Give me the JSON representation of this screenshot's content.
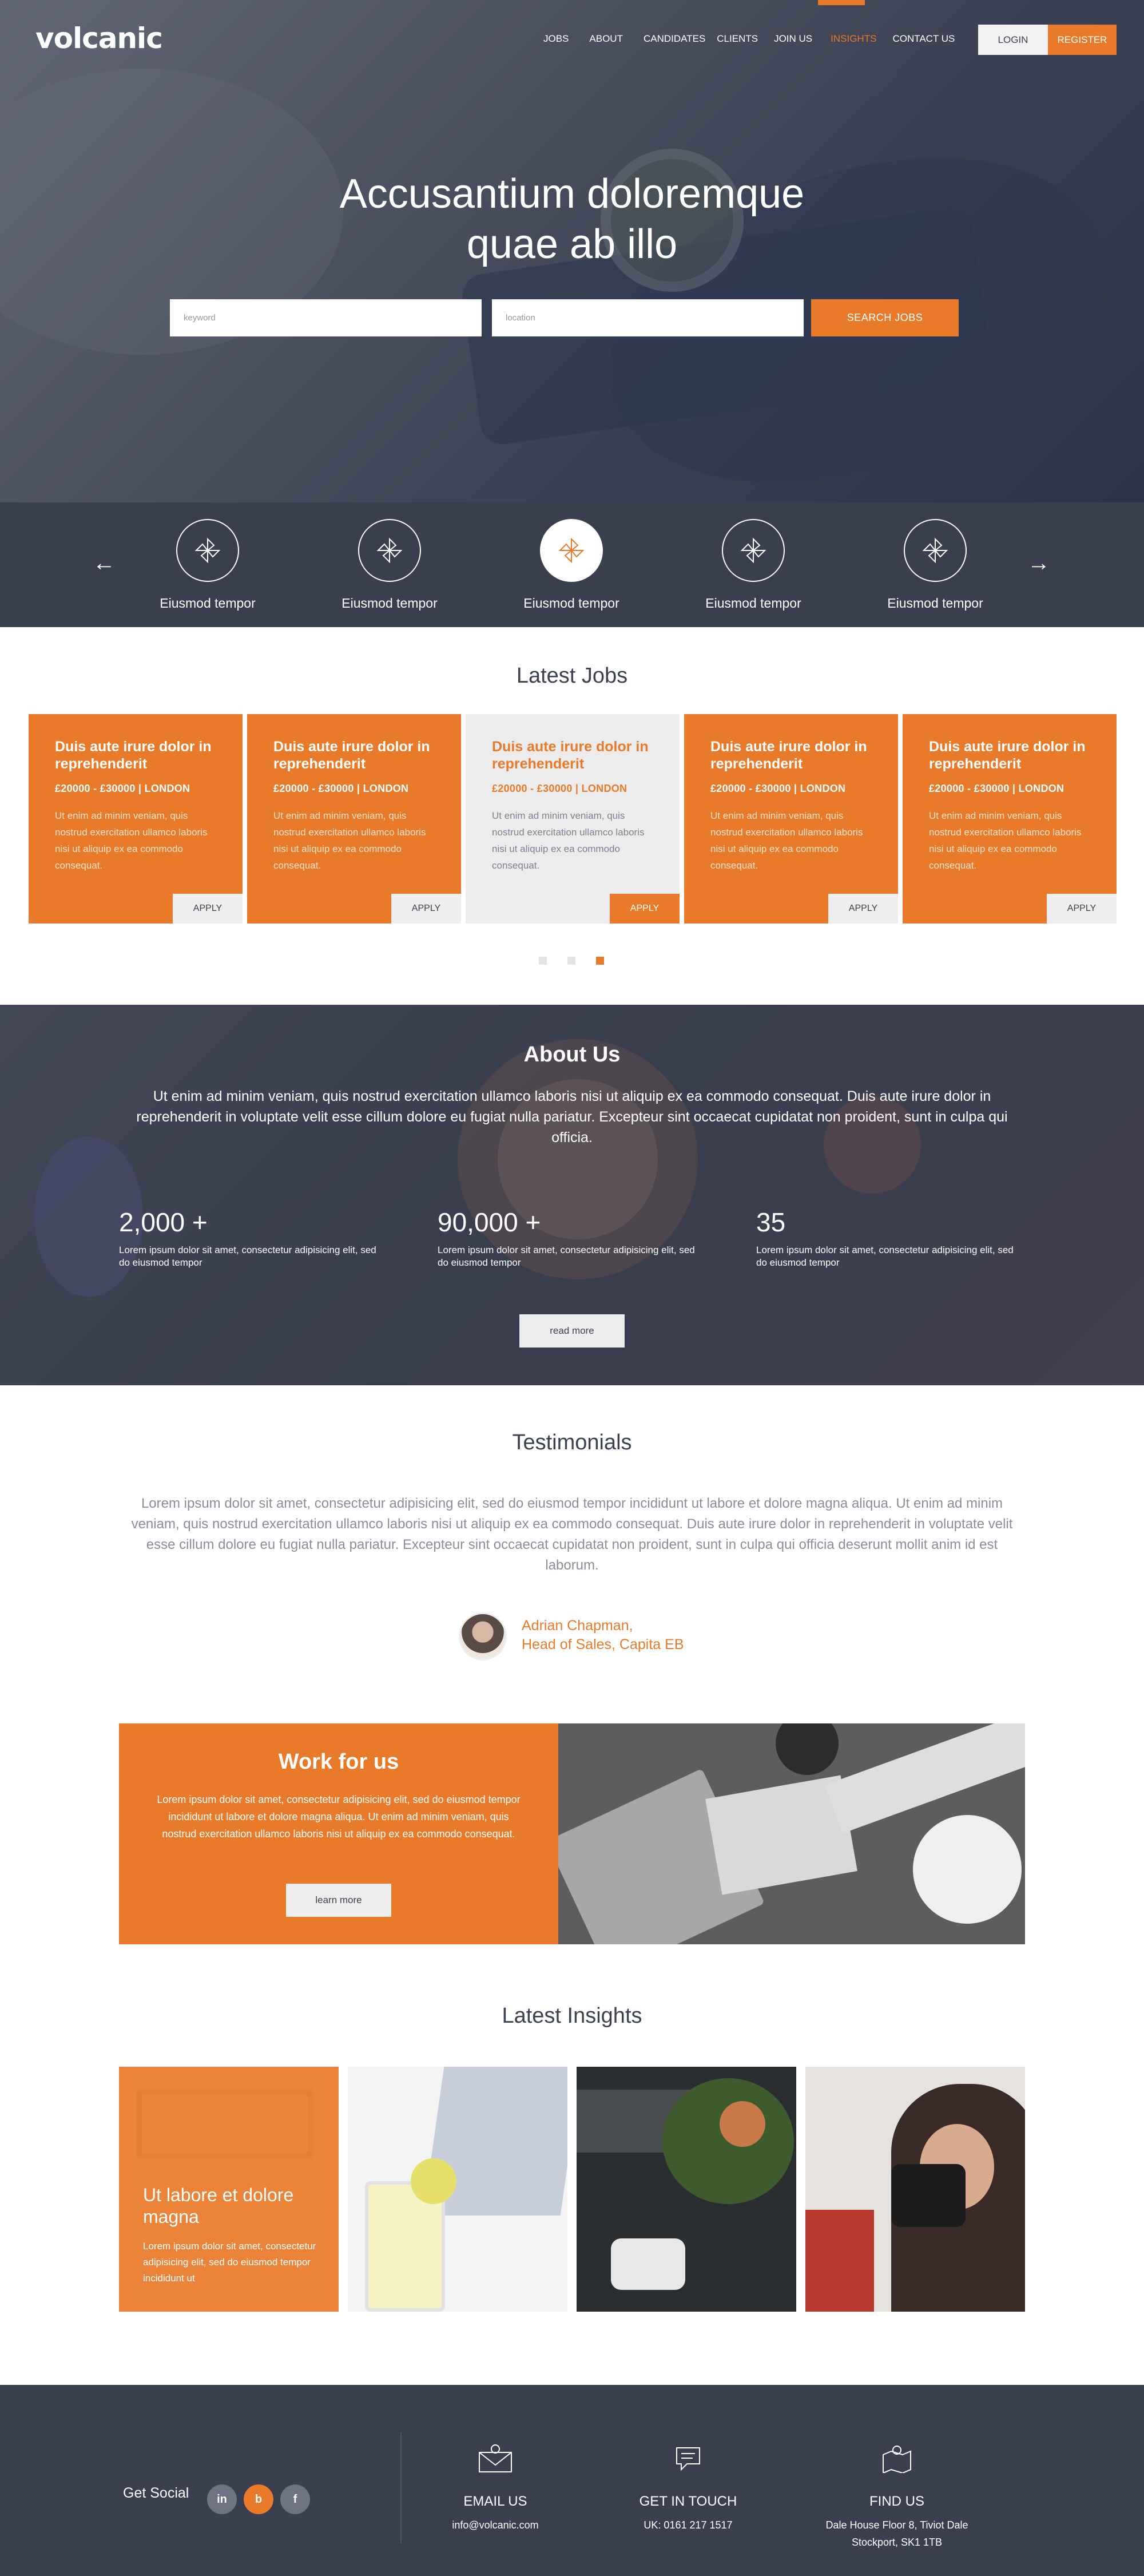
{
  "brand": {
    "logo": "volcanic",
    "accent_color": "#e87a2a",
    "dark_color": "#3a3f50"
  },
  "nav": {
    "items": [
      "JOBS",
      "ABOUT",
      "CANDIDATES",
      "CLIENTS",
      "JOIN US",
      "INSIGHTS",
      "CONTACT US"
    ],
    "active": "INSIGHTS",
    "login": "LOGIN",
    "register": "REGISTER"
  },
  "hero": {
    "title_line1": "Accusantium doloremque",
    "title_line2": "quae ab illo",
    "keyword_placeholder": "keyword",
    "location_placeholder": "location",
    "search_button": "SEARCH JOBS"
  },
  "categories": {
    "items": [
      "Eiusmod tempor",
      "Eiusmod tempor",
      "Eiusmod tempor",
      "Eiusmod tempor",
      "Eiusmod tempor"
    ],
    "icon": "pinwheel-icon",
    "active_index": 2
  },
  "latest_jobs": {
    "title": "Latest Jobs",
    "cards": [
      {
        "title": "Duis aute irure dolor in reprehenderit",
        "salary": "£20000 - £30000 | LONDON",
        "desc": "Ut enim ad minim veniam, quis nostrud exercitation ullamco laboris nisi ut aliquip ex ea commodo consequat.",
        "apply": "APPLY"
      },
      {
        "title": "Duis aute irure dolor in reprehenderit",
        "salary": "£20000 - £30000 | LONDON",
        "desc": "Ut enim ad minim veniam, quis nostrud exercitation ullamco laboris nisi ut aliquip ex ea commodo consequat.",
        "apply": "APPLY"
      },
      {
        "title": "Duis aute irure dolor in reprehenderit",
        "salary": "£20000 - £30000 | LONDON",
        "desc": "Ut enim ad minim veniam, quis nostrud exercitation ullamco laboris nisi ut aliquip ex ea commodo consequat.",
        "apply": "APPLY"
      },
      {
        "title": "Duis aute irure dolor in reprehenderit",
        "salary": "£20000 - £30000 | LONDON",
        "desc": "Ut enim ad minim veniam, quis nostrud exercitation ullamco laboris nisi ut aliquip ex ea commodo consequat.",
        "apply": "APPLY"
      },
      {
        "title": "Duis aute irure dolor in reprehenderit",
        "salary": "£20000 - £30000 | LONDON",
        "desc": "Ut enim ad minim veniam, quis nostrud exercitation ullamco laboris nisi ut aliquip ex ea commodo consequat.",
        "apply": "APPLY"
      }
    ],
    "highlighted_index": 2,
    "active_dot": 2
  },
  "about": {
    "title": "About Us",
    "text": "Ut enim ad minim veniam, quis nostrud exercitation ullamco laboris nisi ut aliquip ex ea commodo consequat. Duis aute irure dolor in reprehenderit in voluptate velit esse cillum dolore eu fugiat nulla pariatur. Excepteur sint occaecat cupidatat non proident, sunt in culpa qui officia.",
    "stats": [
      {
        "num": "2,000 +",
        "text": "Lorem ipsum dolor sit amet, consectetur adipisicing elit, sed do eiusmod tempor"
      },
      {
        "num": "90,000 +",
        "text": "Lorem ipsum dolor sit amet, consectetur adipisicing elit, sed do eiusmod tempor"
      },
      {
        "num": "35",
        "text": "Lorem ipsum dolor sit amet, consectetur adipisicing elit, sed do eiusmod tempor"
      }
    ],
    "button": "read more"
  },
  "testimonials": {
    "title": "Testimonials",
    "quote": "Lorem ipsum dolor sit amet, consectetur adipisicing elit, sed do eiusmod tempor incididunt ut labore et dolore magna aliqua. Ut enim ad minim veniam, quis nostrud exercitation ullamco laboris nisi ut aliquip ex ea commodo consequat. Duis aute irure dolor in reprehenderit in voluptate velit esse cillum dolore eu fugiat nulla pariatur. Excepteur sint occaecat cupidatat non proident, sunt in culpa qui officia deserunt mollit anim id est laborum.",
    "author_name": "Adrian Chapman,",
    "author_role": "Head of Sales, Capita EB"
  },
  "work": {
    "title": "Work for us",
    "text": "Lorem ipsum dolor sit amet, consectetur adipisicing elit, sed do eiusmod tempor incididunt ut labore et dolore magna aliqua. Ut enim ad minim veniam, quis nostrud exercitation ullamco laboris nisi ut aliquip ex ea commodo consequat.",
    "button": "learn more"
  },
  "insights": {
    "title": "Latest Insights",
    "featured_title": "Ut labore et dolore magna",
    "featured_text": "Lorem ipsum dolor sit amet, consectetur adipisicing elit, sed do eiusmod tempor incididunt ut"
  },
  "footer": {
    "social_label": "Get Social",
    "social": [
      {
        "name": "linkedin-icon",
        "glyph": "in"
      },
      {
        "name": "blogger-icon",
        "glyph": "b"
      },
      {
        "name": "facebook-icon",
        "glyph": "f"
      }
    ],
    "email_title": "EMAIL US",
    "email": "info@volcanic.com",
    "touch_title": "GET IN TOUCH",
    "phone": "UK: 0161 217 1517",
    "find_title": "FIND US",
    "address_line1": "Dale House Floor 8, Tiviot Dale",
    "address_line2": "Stockport, SK1 1TB"
  }
}
